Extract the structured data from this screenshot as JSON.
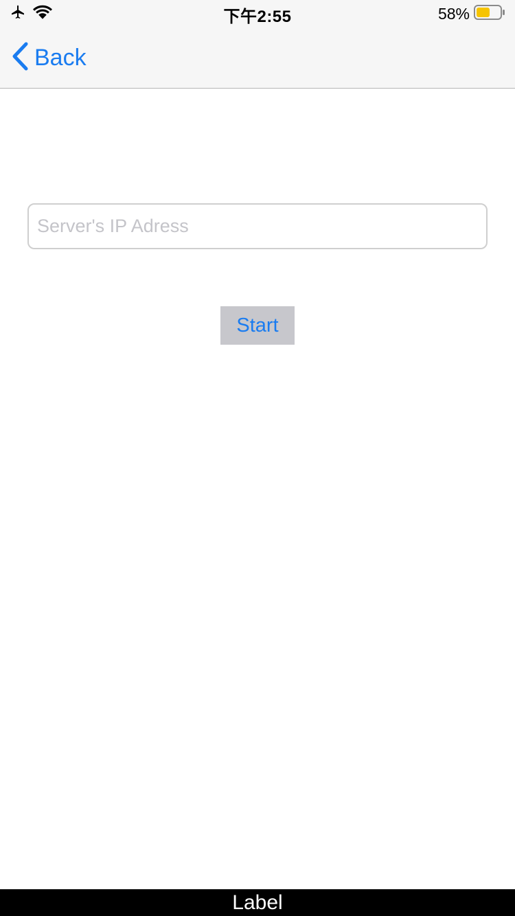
{
  "status_bar": {
    "time": "下午2:55",
    "battery_percent": "58%",
    "battery_level": 0.58,
    "battery_color": "#f6c400",
    "icons": [
      "airplane-icon",
      "wifi-icon",
      "battery-icon"
    ]
  },
  "nav": {
    "back_label": "Back",
    "accent_color": "#1a7cf0"
  },
  "form": {
    "ip_placeholder": "Server's IP Adress",
    "ip_value": "",
    "start_label": "Start"
  },
  "footer": {
    "label": "Label"
  }
}
